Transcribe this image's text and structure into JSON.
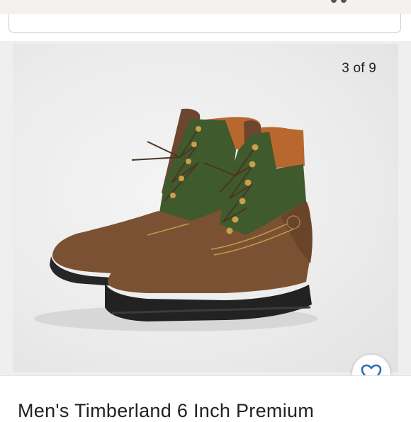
{
  "header": {
    "icon": "more-dots-icon"
  },
  "search": {
    "placeholder": ""
  },
  "gallery": {
    "counter": "3 of 9",
    "image_alt": "Brown suede boots with green panels and orange collars",
    "favorite_icon": "heart-icon"
  },
  "listing": {
    "title": "Men's Timberland 6 Inch Premium"
  },
  "colors": {
    "accent": "#2b6fb3",
    "boot_brown": "#7a5233",
    "boot_green": "#3f5a2c",
    "collar_orange": "#b8682e"
  }
}
